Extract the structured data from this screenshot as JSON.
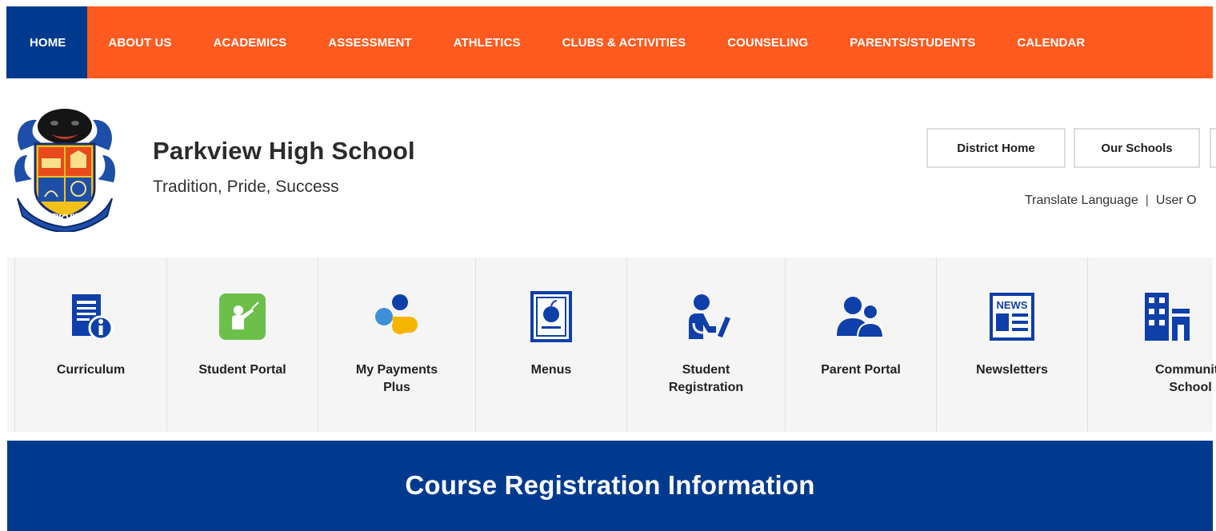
{
  "nav": {
    "items": [
      {
        "label": "HOME",
        "active": true
      },
      {
        "label": "ABOUT US"
      },
      {
        "label": "ACADEMICS"
      },
      {
        "label": "ASSESSMENT"
      },
      {
        "label": "ATHLETICS"
      },
      {
        "label": "CLUBS & ACTIVITIES"
      },
      {
        "label": "COUNSELING"
      },
      {
        "label": "PARENTS/STUDENTS"
      },
      {
        "label": "CALENDAR"
      }
    ]
  },
  "header": {
    "school_name": "Parkview High School",
    "tagline": "Tradition, Pride, Success",
    "crest_text": "PARKVIEW",
    "buttons": {
      "district_home": "District Home",
      "our_schools": "Our Schools"
    },
    "util_links": {
      "translate": "Translate Language",
      "separator": "|",
      "user_options": "User O"
    }
  },
  "quick_links": [
    {
      "label": "Curriculum",
      "icon": "curriculum-info-icon"
    },
    {
      "label": "Student Portal",
      "icon": "student-portal-icon"
    },
    {
      "label": "My Payments Plus",
      "icon": "payments-plus-icon"
    },
    {
      "label": "Menus",
      "icon": "menu-apple-icon"
    },
    {
      "label": "Student Registration",
      "icon": "student-registration-icon"
    },
    {
      "label": "Parent Portal",
      "icon": "parent-portal-icon"
    },
    {
      "label": "Newsletters",
      "icon": "newsletter-icon"
    },
    {
      "label": "Community School",
      "icon": "community-building-icon"
    }
  ],
  "banner": {
    "title": "Course Registration Information"
  },
  "colors": {
    "nav_orange": "#ff5a1f",
    "navy": "#003a8f",
    "icon_blue": "#0f3fa8",
    "green": "#6cc04a",
    "yellow": "#f7b500",
    "light_blue": "#3f8fd6"
  }
}
